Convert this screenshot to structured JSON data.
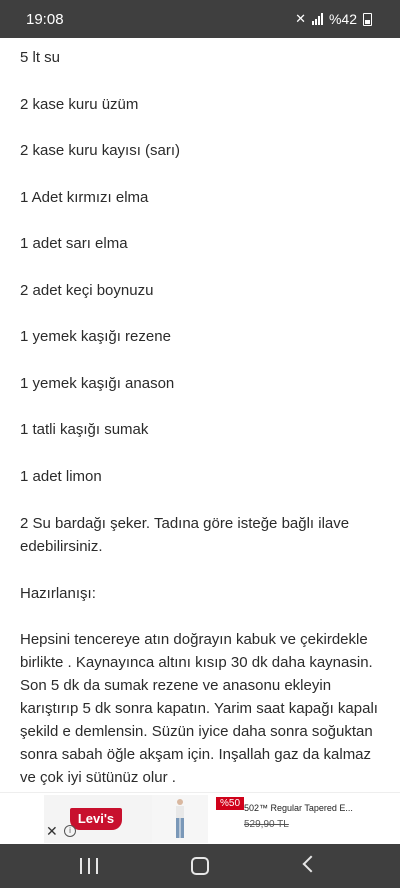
{
  "status_bar": {
    "time": "19:08",
    "battery_text": "%42"
  },
  "recipe": {
    "ingredients": [
      "5 lt su",
      "2  kase kuru üzüm",
      "2  kase kuru kayısı (sarı)",
      "1 Adet kırmızı elma",
      "1 adet sarı elma",
      "2 adet keçi boynuzu",
      "1 yemek kaşığı rezene",
      "1 yemek kaşığı anason",
      "1 tatli kaşığı sumak",
      "1 adet limon",
      "2 Su bardağı şeker.  Tadına göre isteğe bağlı ilave edebilirsiniz."
    ],
    "method_heading": "Hazırlanışı:",
    "method_text": "Hepsini tencereye atın doğrayın kabuk ve çekirdekle birlikte . Kaynayınca altını kısıp 30 dk daha kaynasin. Son 5 dk da sumak rezene ve anasonu ekleyin karıştırıp 5 dk sonra kapatın. Yarim saat kapağı kapalı şekild e demlensin.  Süzün iyice daha sonra soğuktan sonra sabah öğle akşam için.  Inşallah gaz da kalmaz ve çok iyi sütünüz olur ."
  },
  "ad": {
    "brand": "Levi's",
    "discount": "%50",
    "product_title": "502™ Regular Tapered E...",
    "price": "529,90 TL",
    "brand_color": "#c8102e"
  },
  "nav": {
    "recent_icon": "recent-apps-icon",
    "home_icon": "home-icon",
    "back_icon": "back-icon"
  }
}
